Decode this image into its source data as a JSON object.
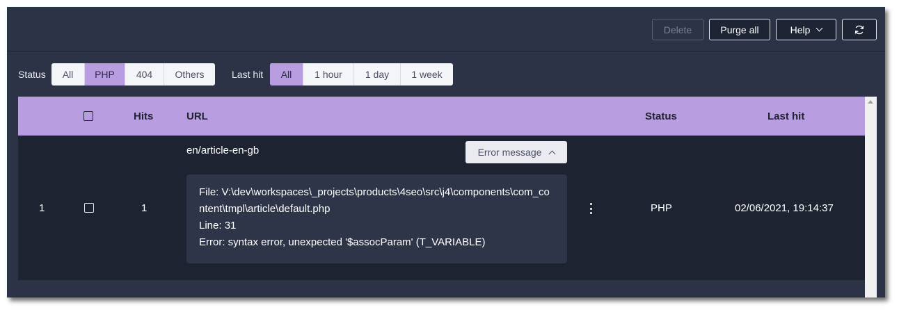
{
  "toolbar": {
    "delete_label": "Delete",
    "purge_label": "Purge all",
    "help_label": "Help",
    "refresh_icon": "refresh-icon"
  },
  "filters": {
    "status_label": "Status",
    "status_options": [
      "All",
      "PHP",
      "404",
      "Others"
    ],
    "status_selected": "PHP",
    "lasthit_label": "Last hit",
    "lasthit_options": [
      "All",
      "1 hour",
      "1 day",
      "1 week"
    ],
    "lasthit_selected": "All"
  },
  "table": {
    "columns": {
      "hits": "Hits",
      "url": "URL",
      "status": "Status",
      "last_hit": "Last hit"
    },
    "rows": [
      {
        "index": "1",
        "hits": "1",
        "url": "en/article-en-gb",
        "error_button_label": "Error message",
        "error_lines": [
          "File: V:\\dev\\workspaces\\_projects\\products\\4seo\\src\\j4\\components\\com_content\\tmpl\\article\\default.php",
          "Line: 31",
          "Error: syntax error, unexpected '$assocParam' (T_VARIABLE)"
        ],
        "status": "PHP",
        "last_hit": "02/06/2021, 19:14:37"
      }
    ]
  },
  "colors": {
    "accent": "#b89ee0",
    "background": "#2c3346",
    "row_background": "#1e2331"
  }
}
